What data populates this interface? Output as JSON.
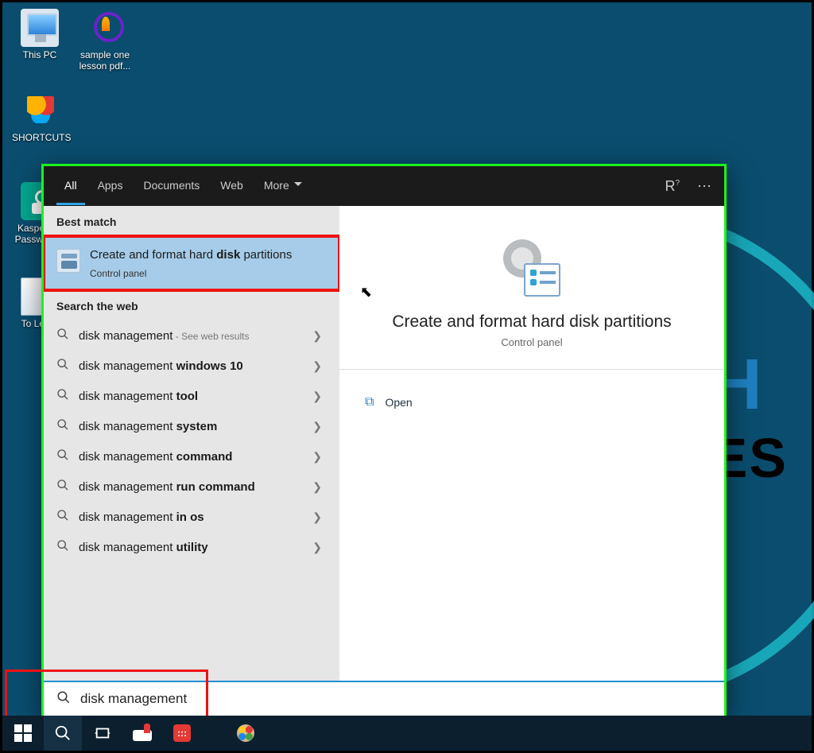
{
  "desktop": {
    "icons": [
      {
        "label": "This PC"
      },
      {
        "label": "sample one lesson pdf..."
      },
      {
        "label": "SHORTCUTS"
      },
      {
        "label": "Kaspersky Password..."
      },
      {
        "label": "To Learn"
      }
    ]
  },
  "search": {
    "tabs": {
      "all": "All",
      "apps": "Apps",
      "documents": "Documents",
      "web": "Web",
      "more": "More"
    },
    "sections": {
      "best_match": "Best match",
      "search_web": "Search the web"
    },
    "best_match": {
      "title_pre": "Create and format hard ",
      "title_bold": "disk",
      "title_post": " partitions",
      "subtitle": "Control panel"
    },
    "web_results": [
      {
        "pre": "disk management",
        "bold": "",
        "note": " - See web results"
      },
      {
        "pre": "disk management ",
        "bold": "windows 10",
        "note": ""
      },
      {
        "pre": "disk management ",
        "bold": "tool",
        "note": ""
      },
      {
        "pre": "disk management ",
        "bold": "system",
        "note": ""
      },
      {
        "pre": "disk management ",
        "bold": "command",
        "note": ""
      },
      {
        "pre": "disk management ",
        "bold": "run command",
        "note": ""
      },
      {
        "pre": "disk management ",
        "bold": "in os",
        "note": ""
      },
      {
        "pre": "disk management ",
        "bold": "utility",
        "note": ""
      }
    ],
    "detail": {
      "title": "Create and format hard disk partitions",
      "subtitle": "Control panel",
      "open": "Open"
    },
    "query": "disk management"
  }
}
